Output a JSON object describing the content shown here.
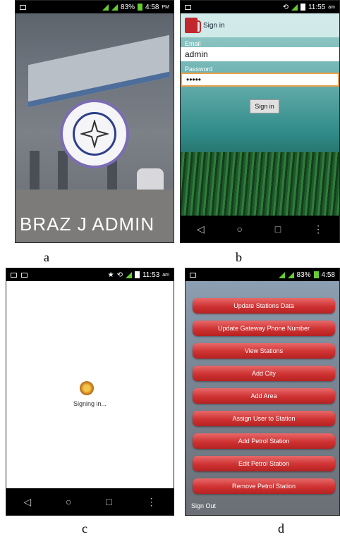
{
  "screen_a": {
    "status": {
      "battery": "83%",
      "time": "4:58",
      "ampm": "PM"
    },
    "brand": "BRAZ J ADMIN",
    "caption": "a"
  },
  "screen_b": {
    "status": {
      "time": "11:55",
      "ampm": "am"
    },
    "title": "Sign in",
    "email_label": "Email",
    "email_value": "admin",
    "password_label": "Password",
    "password_value": "•••••",
    "button": "Sign in",
    "nav": {
      "back": "◁",
      "home": "○",
      "recent": "□",
      "more": "⋮"
    },
    "caption": "b"
  },
  "screen_c": {
    "status": {
      "time": "11:53",
      "ampm": "am"
    },
    "loading_text": "Signing in...",
    "nav": {
      "back": "◁",
      "home": "○",
      "recent": "□",
      "more": "⋮"
    },
    "caption": "c"
  },
  "screen_d": {
    "status": {
      "battery": "83%",
      "time": "4:58"
    },
    "menu": [
      "Update Stations Data",
      "Update Gateway Phone Number",
      "View Stations",
      "Add City",
      "Add Area",
      "Assign User to Station",
      "Add Petrol Station",
      "Edit Petrol Station",
      "Remove Petrol Station"
    ],
    "sign_out": "Sign Out",
    "caption": "d"
  }
}
